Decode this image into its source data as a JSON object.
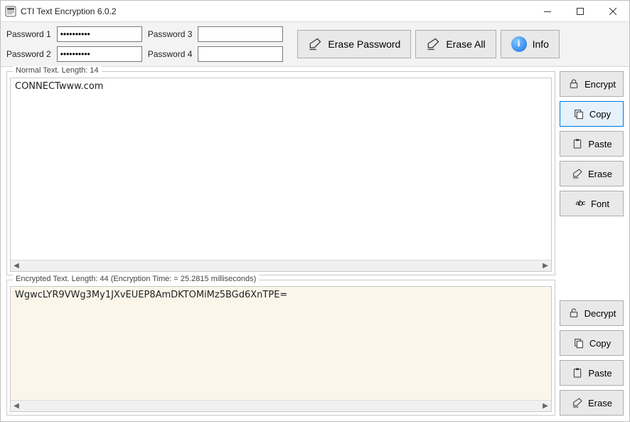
{
  "window": {
    "title": "CTI Text Encryption 6.0.2"
  },
  "passwords": {
    "label1": "Password 1",
    "label2": "Password 2",
    "label3": "Password 3",
    "label4": "Password 4",
    "value1": "••••••••••",
    "value2": "••••••••••",
    "value3": "",
    "value4": ""
  },
  "topButtons": {
    "erasePassword": "Erase Password",
    "eraseAll": "Erase All",
    "info": "Info"
  },
  "normalPanel": {
    "legend": "Normal Text. Length: 14",
    "text": "CONNECTwww.com"
  },
  "encryptedPanel": {
    "legend": "Encrypted Text. Length: 44  (Encryption Time: = 25.2815 milliseconds)",
    "text": "WgwcLYR9VWg3My1JXvEUEP8AmDKTOMiMz5BGd6XnTPE="
  },
  "sideTop": {
    "encrypt": "Encrypt",
    "copy": "Copy",
    "paste": "Paste",
    "erase": "Erase",
    "font": "Font"
  },
  "sideBottom": {
    "decrypt": "Decrypt",
    "copy": "Copy",
    "paste": "Paste",
    "erase": "Erase"
  }
}
